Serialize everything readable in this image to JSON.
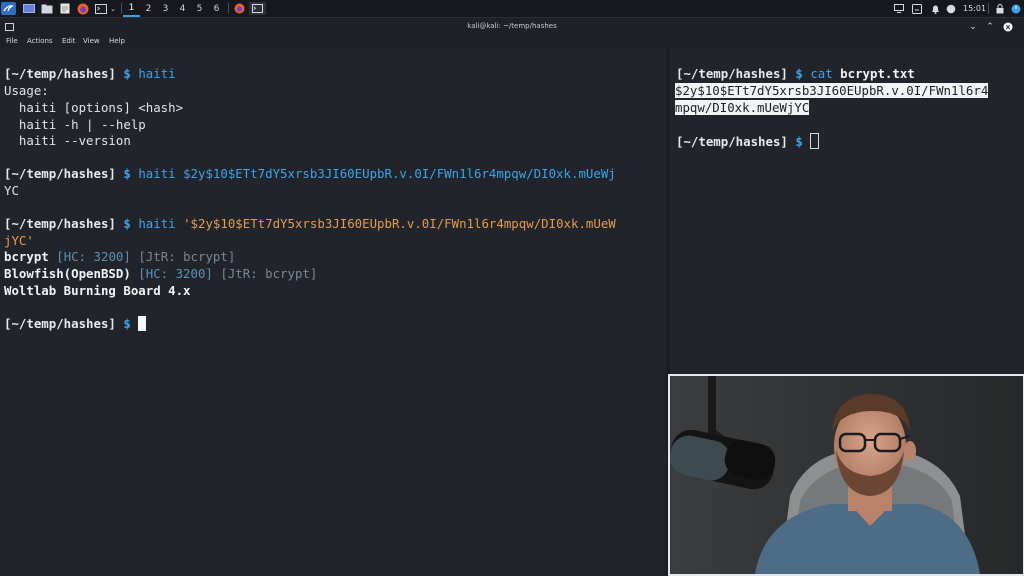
{
  "panel": {
    "workspaces": [
      "1",
      "2",
      "3",
      "4",
      "5",
      "6"
    ],
    "clock": "15:01"
  },
  "window": {
    "title": "kali@kali: ~/temp/hashes",
    "menu": [
      "File",
      "Actions",
      "Edit",
      "View",
      "Help"
    ]
  },
  "left": {
    "prompt": "[~/temp/hashes]",
    "dollar": "$",
    "cmd1": "haiti",
    "usage": "Usage:",
    "usage_lines": [
      "  haiti [options] <hash>",
      "  haiti -h | --help",
      "  haiti --version"
    ],
    "cmd2_a": "haiti $2y$10$ETt7dY5xrsb3JI60EUpbR.v.0I/FWn1l6r4mpqw/DI0xk.mUeWj",
    "cmd2_b": "YC",
    "cmd3_prefix": "haiti ",
    "cmd3_str_a": "'$2y$10$ETt7dY5xrsb3JI60EUpbR.v.0I/FWn1l6r4mpqw/DI0xk.mUeW",
    "cmd3_str_b": "jYC'",
    "results": [
      {
        "name": "bcrypt",
        "hc": "[HC: 3200]",
        "jtr": "[JtR: bcrypt]"
      },
      {
        "name": "Blowfish(OpenBSD)",
        "hc": "[HC: 3200]",
        "jtr": "[JtR: bcrypt]"
      },
      {
        "name": "Woltlab Burning Board 4.x",
        "hc": "",
        "jtr": ""
      }
    ]
  },
  "right": {
    "prompt": "[~/temp/hashes]",
    "dollar": "$",
    "cmd": "cat",
    "arg": "bcrypt.txt",
    "out_a": "$2y$10$ETt7dY5xrsb3JI60EUpbR.v.0I/FWn1l6r4",
    "out_b": "mpqw/DI0xk.mUeWjYC"
  },
  "colors": {
    "accent": "#3ea4e8",
    "string": "#e59b4a",
    "background": "#21242b"
  }
}
